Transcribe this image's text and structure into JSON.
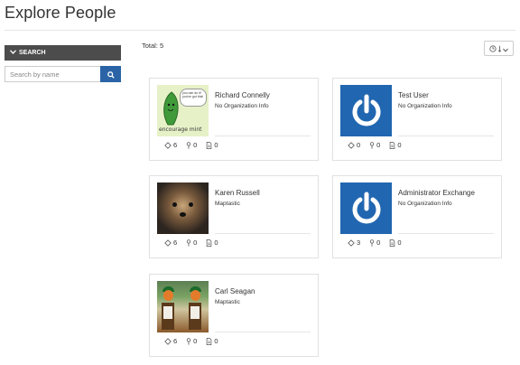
{
  "page": {
    "title": "Explore People"
  },
  "search": {
    "header_label": "SEARCH",
    "placeholder": "Search by name",
    "value": ""
  },
  "results": {
    "total_label": "Total: 5"
  },
  "people": [
    {
      "name": "Richard Connelly",
      "org": "No Organization Info",
      "avatar": "encourage-mint-image",
      "avatar_caption": "encourage mint",
      "avatar_bubble": "you can do it! you've got this!",
      "stats": {
        "groups": "6",
        "maps": "0",
        "documents": "0"
      }
    },
    {
      "name": "Test User",
      "org": "No Organization Info",
      "avatar": "power-icon-image",
      "stats": {
        "groups": "0",
        "maps": "0",
        "documents": "0"
      }
    },
    {
      "name": "Karen Russell",
      "org": "Maptastic",
      "avatar": "dog-photo",
      "stats": {
        "groups": "6",
        "maps": "0",
        "documents": "0"
      }
    },
    {
      "name": "Administrator Exchange",
      "org": "No Organization Info",
      "avatar": "power-icon-image",
      "stats": {
        "groups": "3",
        "maps": "0",
        "documents": "0"
      }
    },
    {
      "name": "Carl Seagan",
      "org": "Maptastic",
      "avatar": "oompa-loompa-photo",
      "stats": {
        "groups": "6",
        "maps": "0",
        "documents": "0"
      }
    }
  ],
  "colors": {
    "accent": "#2a64a6",
    "header_dark": "#4c4c4c",
    "power_blue": "#2166b0"
  }
}
